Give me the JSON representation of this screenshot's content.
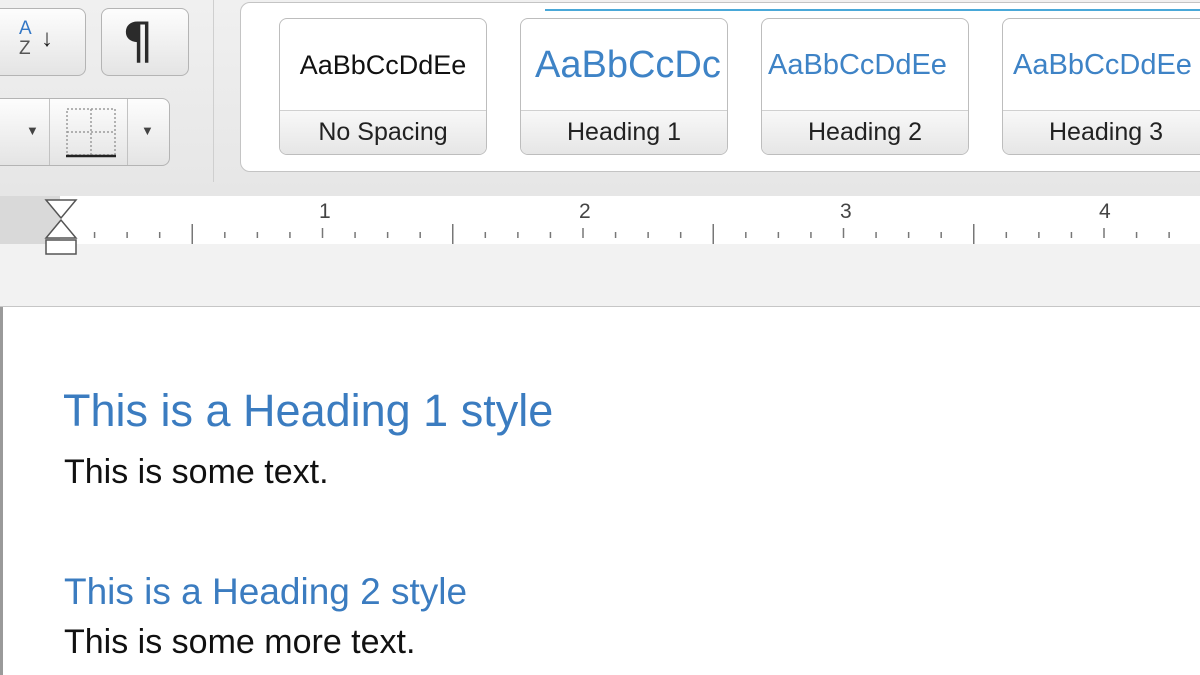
{
  "toolbar": {
    "sort_top": "A",
    "sort_bottom": "Z",
    "sort_arrow": "↓",
    "pilcrow": "¶",
    "caret": "▼",
    "icons": [
      "sort-icon",
      "pilcrow-icon",
      "shading-dropdown-icon",
      "borders-icon"
    ]
  },
  "styles_gallery": {
    "items": [
      {
        "preview": "AaBbCcDdEe",
        "label": "No Spacing"
      },
      {
        "preview": "AaBbCcDc",
        "label": "Heading 1"
      },
      {
        "preview": "AaBbCcDdEe",
        "label": "Heading 2"
      },
      {
        "preview": "AaBbCcDdEe",
        "label": "Heading 3"
      }
    ],
    "accent_color": "#49a8d8"
  },
  "ruler": {
    "numbers": [
      "1",
      "2",
      "3",
      "4"
    ]
  },
  "document": {
    "heading1": "This is a Heading 1 style",
    "text1": "This is some text.",
    "heading2": "This is a Heading 2 style",
    "text2": "This is some more text.",
    "heading_color": "#3b7cc0"
  }
}
